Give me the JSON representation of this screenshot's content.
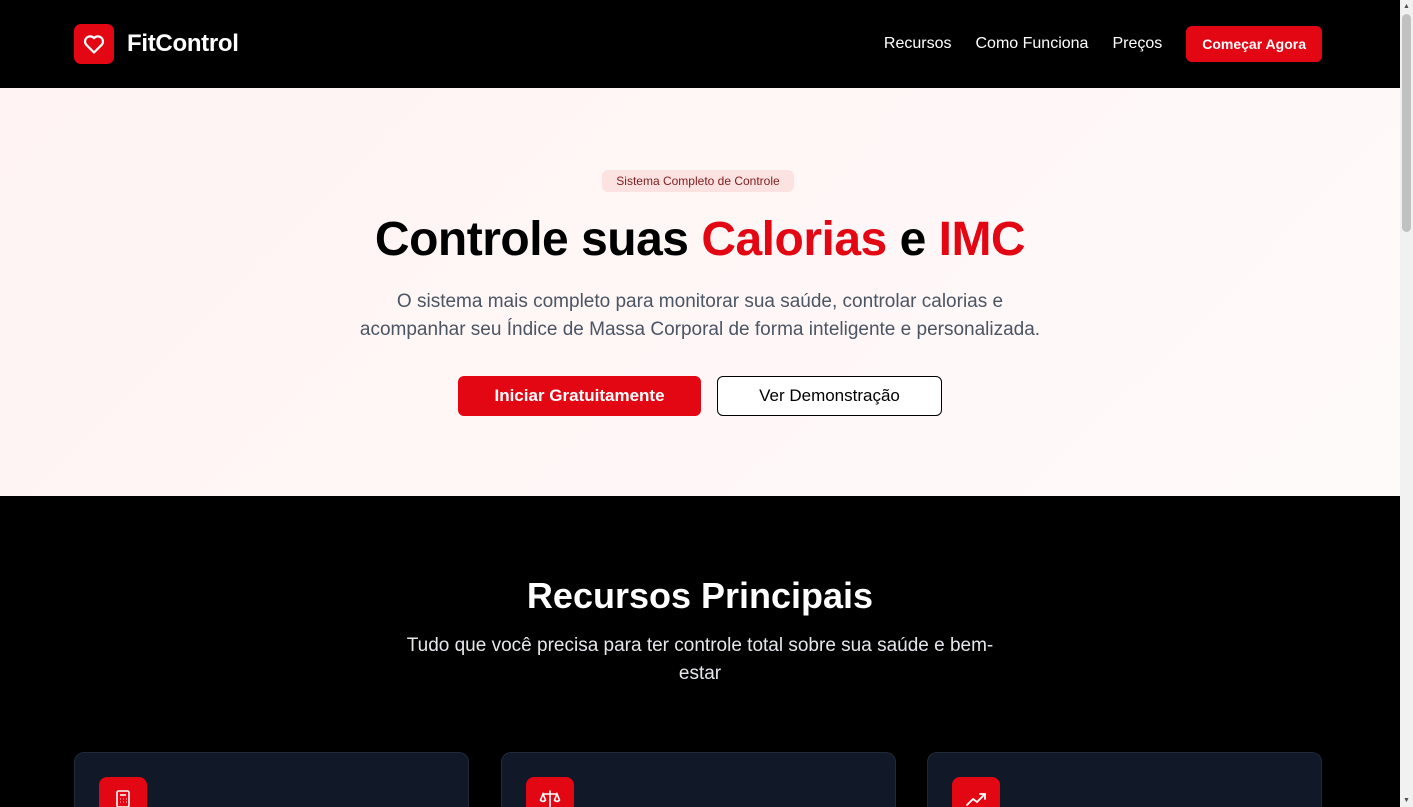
{
  "brand": {
    "name": "FitControl",
    "icon": "heart-icon",
    "color": "#e30613"
  },
  "nav": {
    "links": [
      "Recursos",
      "Como Funciona",
      "Preços"
    ],
    "cta": "Começar Agora"
  },
  "hero": {
    "badge": "Sistema Completo de Controle",
    "title_part1": "Controle suas ",
    "title_highlight1": "Calorias",
    "title_part2": " e ",
    "title_highlight2": "IMC",
    "subtitle_line1": "O sistema mais completo para monitorar sua saúde, controlar calorias e",
    "subtitle_line2": "acompanhar seu Índice de Massa Corporal de forma inteligente e personalizada.",
    "primary_button": "Iniciar Gratuitamente",
    "secondary_button": "Ver Demonstração"
  },
  "features": {
    "title": "Recursos Principais",
    "subtitle_line1": "Tudo que você precisa para ter controle total sobre sua saúde e bem-",
    "subtitle_line2": "estar",
    "cards": [
      {
        "icon": "calculator-icon"
      },
      {
        "icon": "scale-icon"
      },
      {
        "icon": "trending-up-icon"
      }
    ]
  }
}
